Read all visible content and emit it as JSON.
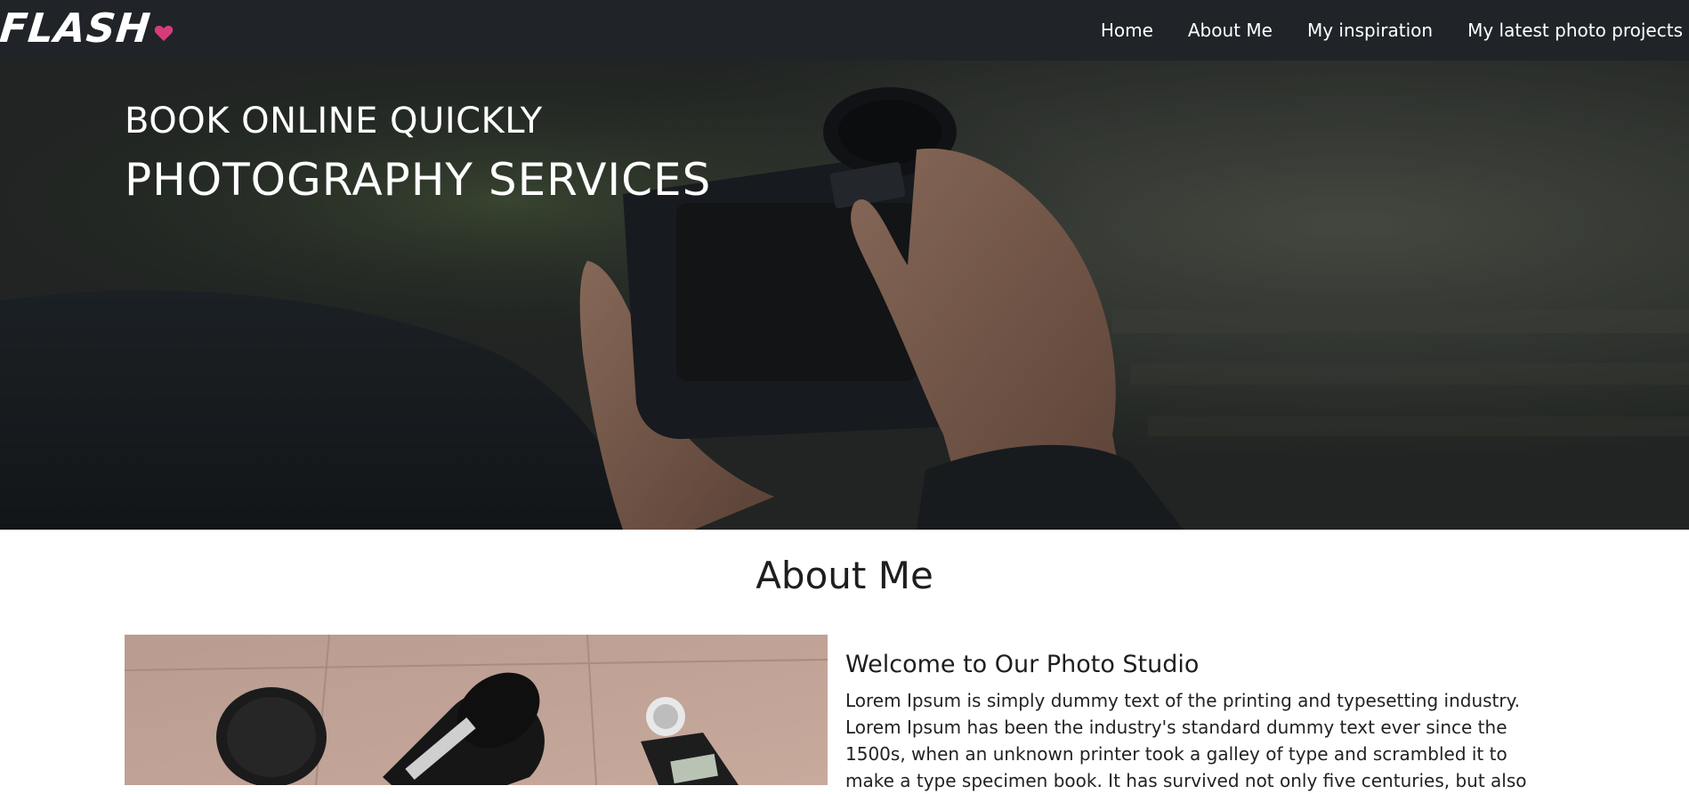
{
  "navbar": {
    "logo_text": "FLASH",
    "logo_icon": "heart-icon",
    "items": [
      {
        "label": "Home"
      },
      {
        "label": "About Me"
      },
      {
        "label": "My inspiration"
      },
      {
        "label": "My latest photo projects"
      }
    ]
  },
  "hero": {
    "subtitle": "BOOK ONLINE QUICKLY",
    "title": "PHOTOGRAPHY SERVICES"
  },
  "about": {
    "heading": "About Me",
    "welcome": "Welcome to Our Photo Studio",
    "body": "Lorem Ipsum is simply dummy text of the printing and typesetting industry. Lorem Ipsum has been the industry's standard dummy text ever since the 1500s, when an unknown printer took a galley of type and scrambled it to make a type specimen book. It has survived not only five centuries, but also"
  },
  "colors": {
    "navbar_bg": "#202429",
    "accent": "#d63c7c",
    "text_dark": "#1e1e1e"
  }
}
